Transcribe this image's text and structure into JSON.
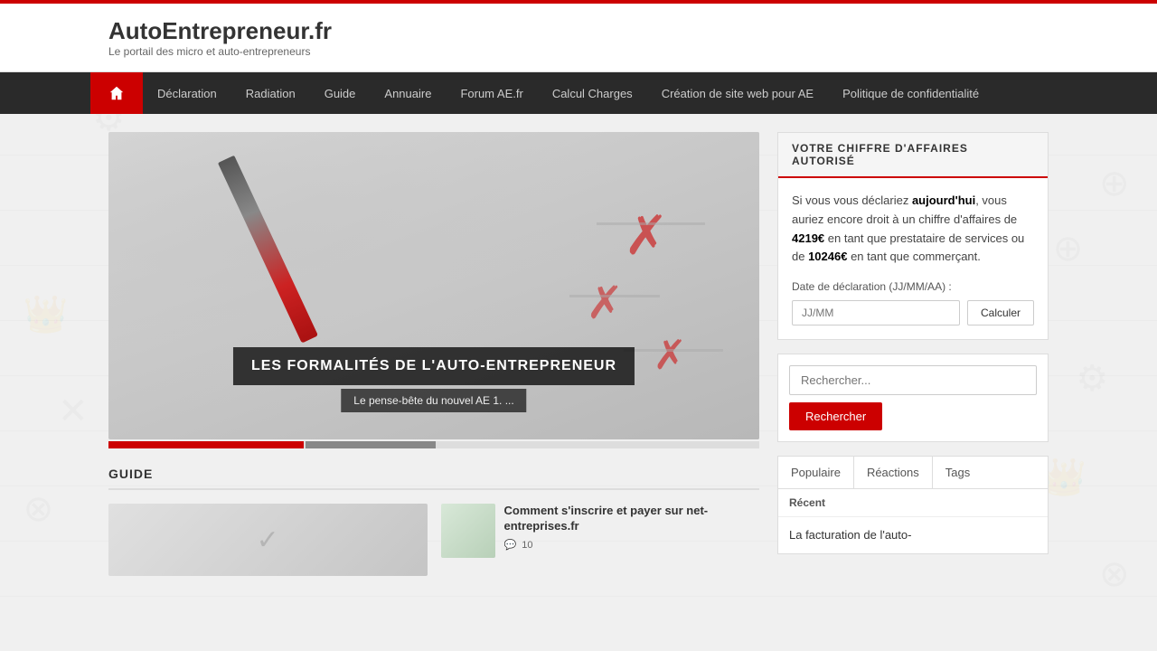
{
  "site": {
    "title": "AutoEntrepreneur.fr",
    "subtitle": "Le portail des micro et auto-entrepreneurs"
  },
  "nav": {
    "home_label": "home",
    "items": [
      {
        "label": "Déclaration",
        "id": "declaration"
      },
      {
        "label": "Radiation",
        "id": "radiation"
      },
      {
        "label": "Guide",
        "id": "guide"
      },
      {
        "label": "Annuaire",
        "id": "annuaire"
      },
      {
        "label": "Forum AE.fr",
        "id": "forum"
      },
      {
        "label": "Calcul Charges",
        "id": "calcul"
      },
      {
        "label": "Création de site web pour AE",
        "id": "creation"
      },
      {
        "label": "Politique de confidentialité",
        "id": "politique"
      }
    ]
  },
  "hero": {
    "title": "LES FORMALITÉS DE L'AUTO-ENTREPRENEUR",
    "subtitle": "Le pense-bête du nouvel AE 1. ..."
  },
  "ca_widget": {
    "header": "VOTRE CHIFFRE D'AFFAIRES AUTORISÉ",
    "text_part1": "Si vous vous déclariez ",
    "text_bold1": "aujourd'hui",
    "text_part2": ", vous auriez encore droit à un chiffre d'affaires de ",
    "text_bold2": "4219€",
    "text_part3": " en tant que prestataire de services ou de ",
    "text_bold3": "10246€",
    "text_part4": " en tant que commerçant.",
    "date_label": "Date de déclaration (JJ/MM/AA) :",
    "date_placeholder": "JJ/MM",
    "calc_button": "Calculer"
  },
  "search": {
    "placeholder": "Rechercher...",
    "button": "Rechercher"
  },
  "tabs": {
    "items": [
      {
        "label": "Populaire",
        "id": "populaire",
        "active": false
      },
      {
        "label": "Réactions",
        "id": "reactions",
        "active": false
      },
      {
        "label": "Tags",
        "id": "tags",
        "active": false
      }
    ],
    "sub_label": "Récent",
    "recent_text": "La facturation de l'auto-"
  },
  "guide": {
    "title": "GUIDE",
    "items": [
      {
        "id": "item1",
        "title": "Comment s'inscrire et payer sur net-entreprises.fr",
        "comments": 10,
        "has_thumb": true
      }
    ]
  }
}
